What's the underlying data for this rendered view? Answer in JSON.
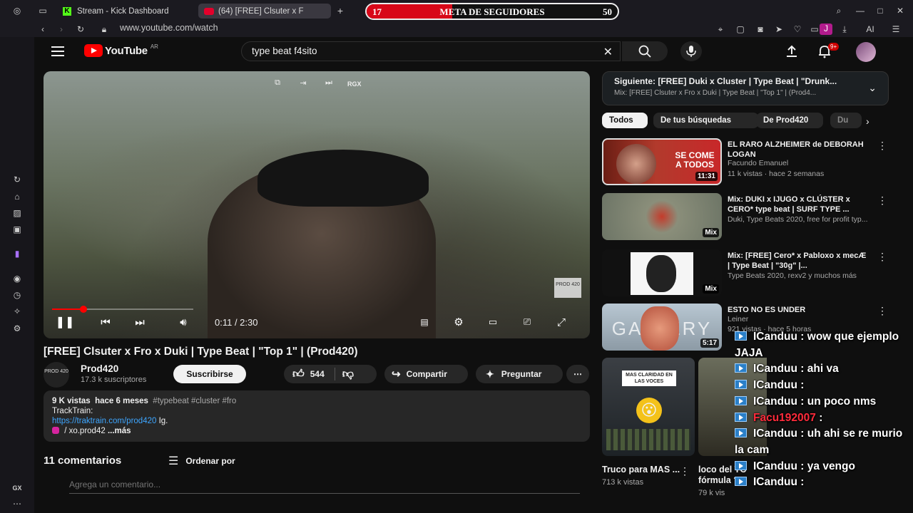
{
  "browser": {
    "tabs": [
      {
        "label": "Stream - Kick Dashboard"
      },
      {
        "label": "(64) [FREE] Clsuter x F"
      }
    ],
    "url": "www.youtube.com/watch",
    "ai_label": "AI",
    "profile_initial": "J",
    "sidebar_gx_label": "GX"
  },
  "overlay_goal": {
    "title": "META DE SEGUIDORES",
    "current": "17",
    "target": "50",
    "progress_fraction": 0.34,
    "fill_color": "#d80718"
  },
  "youtube": {
    "logo_text": "YouTube",
    "country_code": "AR",
    "search_value": "type beat f4sito",
    "notifications_badge": "9+"
  },
  "player": {
    "top_badge": "RGX",
    "watermark": "PROD 420",
    "time": "0:11 / 2:30",
    "progress_fraction": 0.073,
    "progress_color": "#ff0000"
  },
  "video": {
    "title": "[FREE] Clsuter x Fro x Duki | Type Beat | \"Top 1\" | (Prod420)",
    "channel_avatar_text": "PROD 420",
    "channel_name": "Prod420",
    "subscribers": "17.3 k suscriptores",
    "subscribe_label": "Suscribirse",
    "likes": "544",
    "share_label": "Compartir",
    "ask_label": "Preguntar",
    "description": {
      "views": "9 K vistas",
      "date": "hace 6 meses",
      "hashtags": "#typebeat #cluster #fro",
      "line2": "TrackTrain:",
      "link": "https://traktrain.com/prod420",
      "link_suffix": "Ig.",
      "line4": "/ xo.prod42",
      "more": "...más"
    },
    "comments_count": "11 comentarios",
    "sort_label": "Ordenar por",
    "comment_placeholder": "Agrega un comentario..."
  },
  "sidebar_next": {
    "title": "Siguiente: [FREE] Duki x Cluster | Type Beat | \"Drunk...",
    "subtitle": "Mix: [FREE] Clsuter x Fro x Duki | Type Beat | \"Top 1\" | (Prod4..."
  },
  "chips": [
    "Todos",
    "De tus búsquedas",
    "De Prod420",
    "Du"
  ],
  "recommendations": [
    {
      "title": "EL RARO ALZHEIMER de DEBORAH LOGAN",
      "channel": "Facundo Emanuel",
      "stats": "11 k vistas · hace 2 semanas",
      "duration": "11:31",
      "thumb_text": "SE COME A TODOS"
    },
    {
      "title": "Mix: DUKI x IJUGO x CLÚSTER x CERO* type beat | SURF TYPE ...",
      "channel": "Duki, Type Beats 2020, free for profit typ...",
      "stats": "",
      "duration": "Mix",
      "thumb_text": ""
    },
    {
      "title": "Mix: [FREE] Cero* x Pabloxo x mecÆ | Type Beat | \"30g\" |...",
      "channel": "Type Beats 2020, rexv2 y muchos más",
      "stats": "",
      "duration": "Mix",
      "thumb_text": ""
    },
    {
      "title": "ESTO NO ES UNDER",
      "channel": "Leiner",
      "stats": "921 vistas · hace 5 horas",
      "duration": "5:17",
      "thumb_text": "GALLERY"
    }
  ],
  "shorts": [
    {
      "title": "Truco para MAS ...",
      "views": "713 k vistas",
      "thumb_text": "MAS CLARIDAD EN LAS VOCES"
    },
    {
      "title": "loco del TC fórmula ?",
      "views": "79 k vis"
    }
  ],
  "chat": [
    {
      "user": "ICanduu",
      "text": ": wow que ejemplo JAJA",
      "color": "#ffffff"
    },
    {
      "user": "ICanduu",
      "text": ": ahi va",
      "color": "#ffffff"
    },
    {
      "user": "ICanduu",
      "text": ":",
      "color": "#ffffff"
    },
    {
      "user": "ICanduu",
      "text": ": un poco nms",
      "color": "#ffffff"
    },
    {
      "user": "Facu192007",
      "text": ":",
      "color": "#ff2b3b"
    },
    {
      "user": "ICanduu",
      "text": ": uh ahi se re murio la cam",
      "color": "#ffffff"
    },
    {
      "user": "ICanduu",
      "text": ": ya vengo",
      "color": "#ffffff"
    },
    {
      "user": "ICanduu",
      "text": ":",
      "color": "#ffffff"
    }
  ],
  "colors": {
    "yt_red": "#ff0000",
    "kick_green": "#53fc18",
    "link_blue": "#3ea6ff"
  }
}
